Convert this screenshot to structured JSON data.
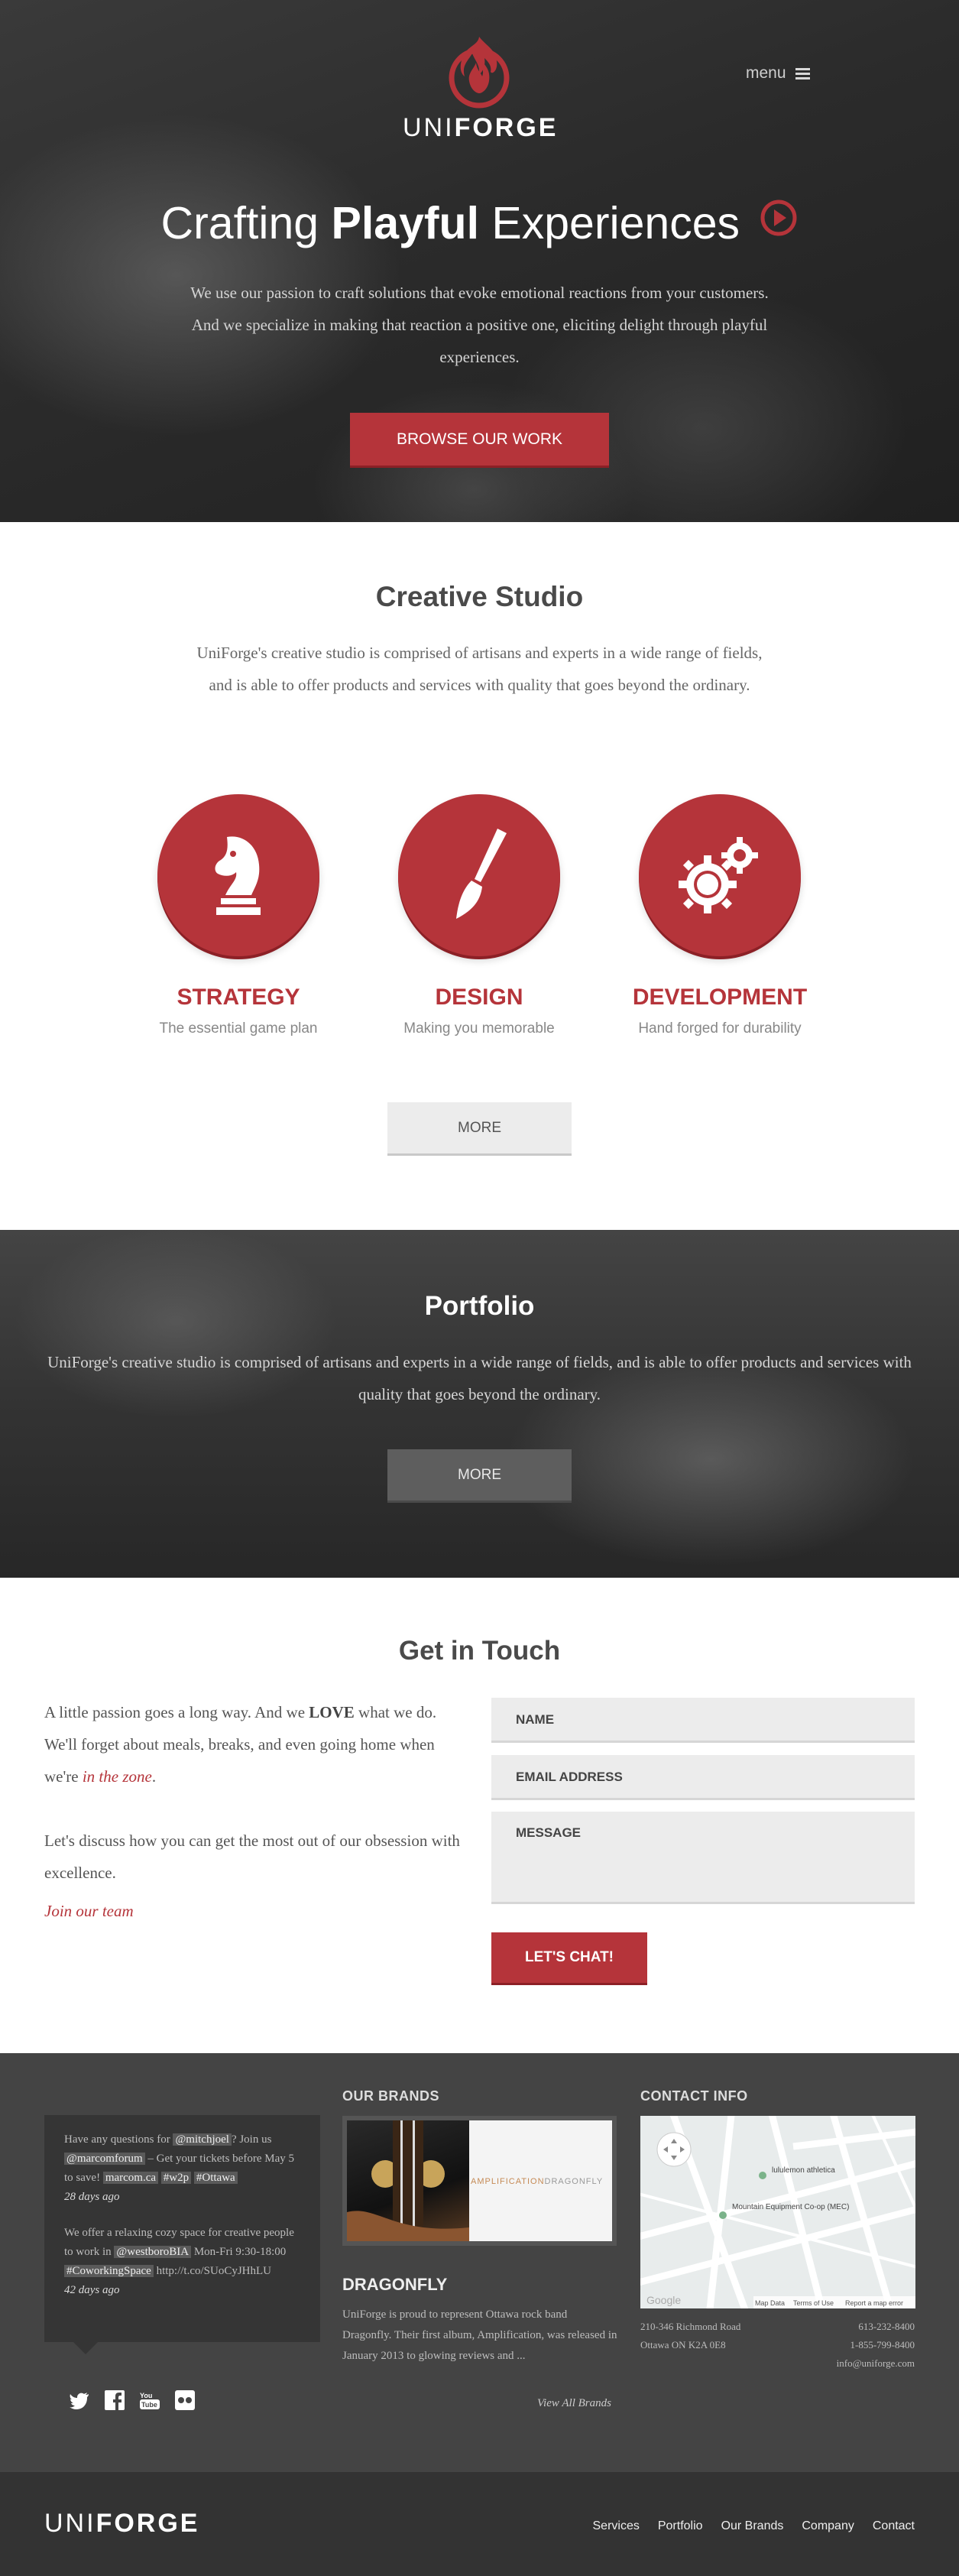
{
  "brand": {
    "name_light": "UNI",
    "name_bold": "FORGE",
    "accent": "#b5343a"
  },
  "header": {
    "menu_label": "menu"
  },
  "hero": {
    "title_pre": "Crafting ",
    "title_bold": "Playful",
    "title_post": " Experiences",
    "subtitle": "We use our passion to craft solutions that evoke emotional reactions from your customers. And we specialize in making that reaction a positive one, eliciting delight through playful experiences.",
    "button": "BROWSE OUR WORK"
  },
  "studio": {
    "title": "Creative Studio",
    "text": "UniForge's creative studio is comprised of artisans and experts in a wide range of fields, and is able to offer products and services with quality that goes beyond the ordinary.",
    "services": [
      {
        "title": "STRATEGY",
        "subtitle": "The essential game plan",
        "icon": "chess-knight-icon"
      },
      {
        "title": "DESIGN",
        "subtitle": "Making you memorable",
        "icon": "paintbrush-icon"
      },
      {
        "title": "DEVELOPMENT",
        "subtitle": "Hand forged for durability",
        "icon": "gears-icon"
      }
    ],
    "more": "MORE"
  },
  "portfolio": {
    "title": "Portfolio",
    "text": "UniForge's creative studio is comprised of artisans and experts in a wide range of fields, and is able to offer products and services with quality that goes beyond the ordinary.",
    "more": "MORE"
  },
  "contact": {
    "title": "Get in Touch",
    "p1_a": "A little passion goes a long way. And we ",
    "p1_bold": "LOVE",
    "p1_b": " what we do. We'll forget about meals, breaks, and even going home when we're ",
    "p1_em": "in the zone",
    "p1_end": ".",
    "p2": "Let's discuss how you can get the most out of our obsession with excellence.",
    "join": "Join our team",
    "fields": {
      "name": "NAME",
      "email": "EMAIL ADDRESS",
      "message": "MESSAGE"
    },
    "button": "LET'S CHAT!"
  },
  "footer": {
    "tweets": [
      {
        "t1": "Have any questions for ",
        "h1": "@mitchjoel",
        "t2": "? Join us ",
        "h2": "@marcomforum",
        "t3": " – Get your tickets before May 5 to save! ",
        "h3": "marcom.ca",
        "t4": " ",
        "h4": "#w2p",
        "t5": " ",
        "h5": "#Ottawa",
        "ago": "28 days ago"
      },
      {
        "t1": "We offer a relaxing cozy space for creative people to work in ",
        "h1": "@westboroBIA",
        "t2": " Mon-Fri 9:30-18:00 ",
        "h2": "#CoworkingSpace",
        "t3": " http://t.co/SUoCyJHhLU",
        "ago": "42 days ago"
      }
    ],
    "brands": {
      "heading": "OUR BRANDS",
      "image_text_a": "AMPLIFICATION",
      "image_text_b": "DRAGONFLY",
      "name": "DRAGONFLY",
      "text": "UniForge is proud to represent Ottawa rock band Dragonfly. Their first album, Amplification, was released in January 2013 to glowing reviews and ...",
      "view_all": "View All Brands"
    },
    "contact_info": {
      "heading": "CONTACT INFO",
      "map_labels": {
        "lululemon": "lululemon athletica",
        "mec": "Mountain Equipment Co-op (MEC)",
        "google": "Google",
        "map_data": "Map Data",
        "terms": "Terms of Use",
        "report": "Report a map error"
      },
      "address1": "210-346 Richmond Road",
      "address2": "Ottawa ON K2A 0E8",
      "phone": "613-232-8400",
      "tollfree": "1-855-799-8400",
      "email": "info@uniforge.com"
    }
  },
  "bottom_nav": [
    "Services",
    "Portfolio",
    "Our Brands",
    "Company",
    "Contact"
  ]
}
